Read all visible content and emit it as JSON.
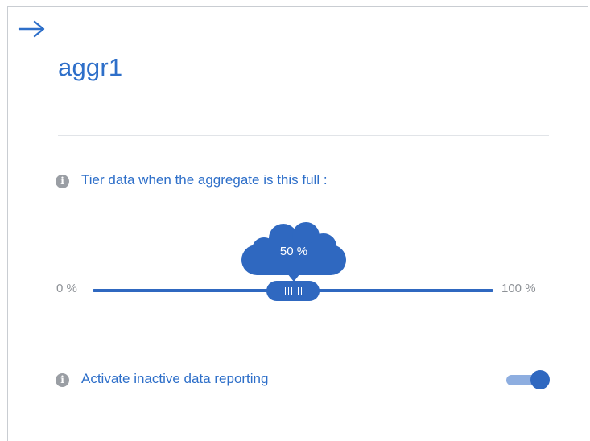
{
  "panel": {
    "title": "aggr1",
    "back_icon": "arrow-right-icon"
  },
  "tiering": {
    "info_icon": "info-icon",
    "label": "Tier data when the aggregate is this full :",
    "slider": {
      "min_label": "0 %",
      "max_label": "100 %",
      "value": 50,
      "value_label": "50 %"
    }
  },
  "reporting": {
    "info_icon": "info-icon",
    "label": "Activate inactive data reporting",
    "enabled": true
  },
  "colors": {
    "accent": "#2f68c0",
    "text_accent": "#2e6fc9",
    "toggle_track_on": "#8eaee0",
    "muted": "#9a9ea4"
  }
}
